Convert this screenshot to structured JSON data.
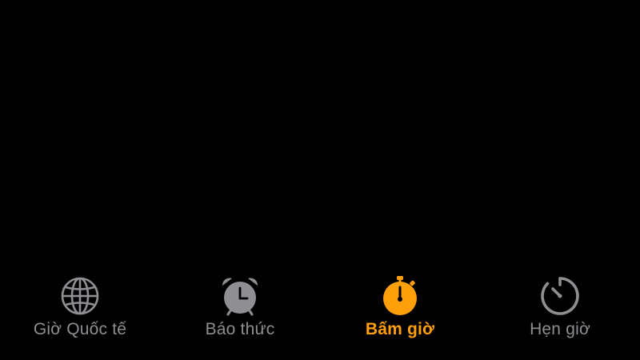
{
  "colors": {
    "background": "#000000",
    "inactive": "#8e8e93",
    "accent": "#ff9f0a"
  },
  "tab_bar": {
    "active_tab": "stopwatch",
    "tabs": [
      {
        "id": "world-clock",
        "label": "Giờ Quốc tế",
        "icon": "globe-icon"
      },
      {
        "id": "alarm",
        "label": "Báo thức",
        "icon": "alarm-clock-icon"
      },
      {
        "id": "stopwatch",
        "label": "Bấm giờ",
        "icon": "stopwatch-icon"
      },
      {
        "id": "timer",
        "label": "Hẹn giờ",
        "icon": "timer-icon"
      }
    ]
  }
}
